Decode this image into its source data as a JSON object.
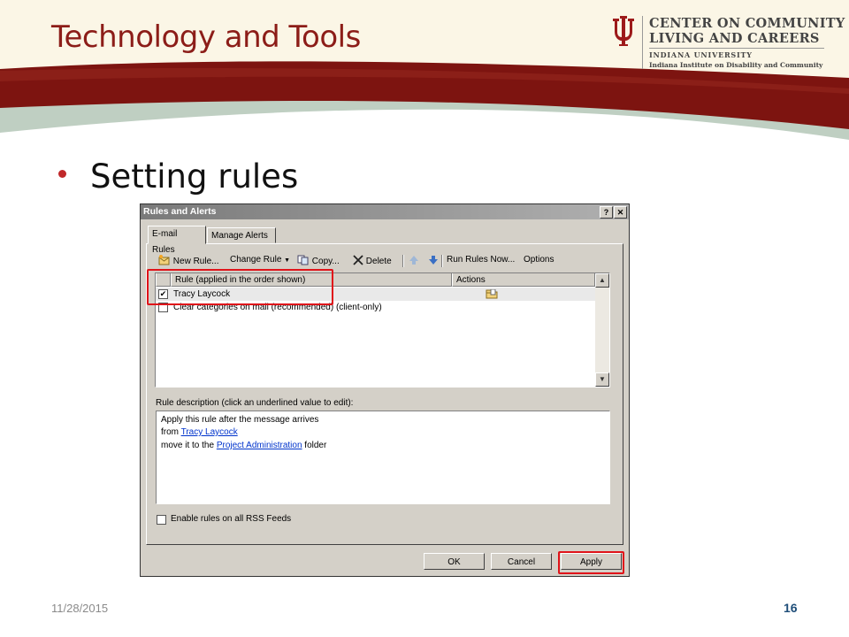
{
  "slide": {
    "title": "Technology and Tools",
    "bullet": "Setting rules",
    "footer_date": "11/28/2015",
    "page_number": "16",
    "colors": {
      "title": "#8c1d18",
      "band_red": "#7d1410",
      "band_green": "#bfcfc2",
      "bullet": "#c0282a",
      "page_number": "#1f4e79"
    }
  },
  "logo": {
    "line1": "CENTER ON COMMUNITY",
    "line2": "LIVING AND CAREERS",
    "line3": "INDIANA UNIVERSITY",
    "line4": "Indiana Institute on Disability and Community"
  },
  "dialog": {
    "title": "Rules and Alerts",
    "help_label": "?",
    "close_label": "✕",
    "tabs": [
      {
        "label": "E-mail Rules",
        "active": true
      },
      {
        "label": "Manage Alerts",
        "active": false
      }
    ],
    "toolbar": {
      "new_rule": "New Rule...",
      "change_rule": "Change Rule",
      "copy": "Copy...",
      "delete": "Delete",
      "run_rules_now": "Run Rules Now...",
      "options": "Options"
    },
    "columns": {
      "rule": "Rule (applied in the order shown)",
      "actions": "Actions"
    },
    "rules": [
      {
        "name": "Tracy Laycock",
        "checked": true
      },
      {
        "name": "Clear categories on mail (recommended)  (client-only)",
        "checked": false
      }
    ],
    "description_label": "Rule description (click an underlined value to edit):",
    "description": {
      "line1": "Apply this rule after the message arrives",
      "line2_prefix": "from ",
      "line2_link": "Tracy Laycock",
      "line3_prefix": "move it to the ",
      "line3_link": "Project Administration",
      "line3_suffix": " folder"
    },
    "rss_label": "Enable rules on all RSS Feeds",
    "rss_checked": false,
    "buttons": {
      "ok": "OK",
      "cancel": "Cancel",
      "apply": "Apply"
    }
  }
}
